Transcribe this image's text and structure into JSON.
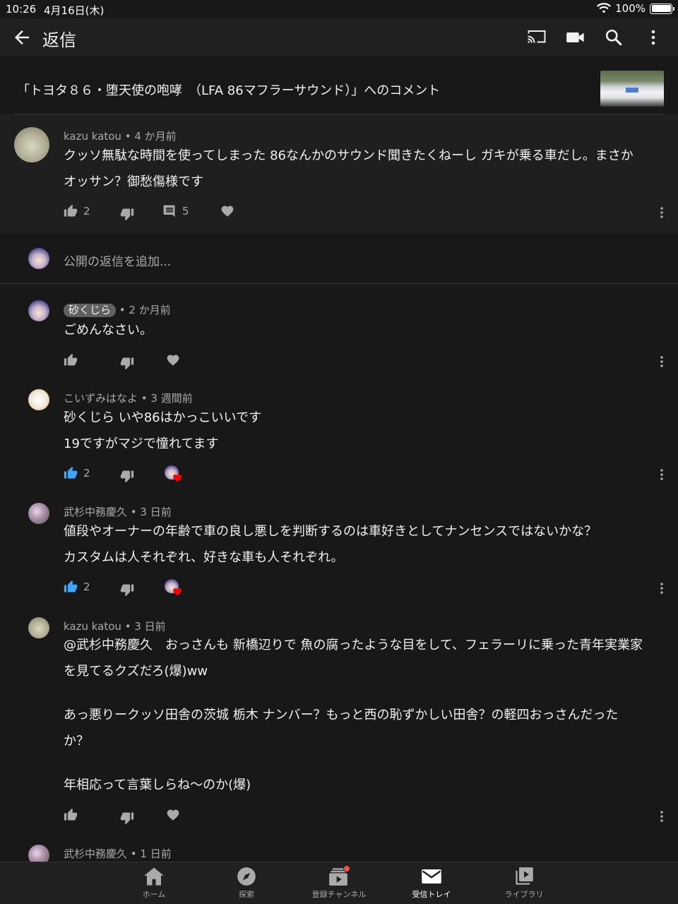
{
  "status_bar": {
    "time": "10:26",
    "date": "4月16日(木)",
    "battery": "100%"
  },
  "app_bar": {
    "title": "返信"
  },
  "video": {
    "title": "「トヨタ８６・堕天使の咆哮　（LFA 86マフラーサウンド）」へのコメント"
  },
  "parent_comment": {
    "author": "kazu katou",
    "time": "4 か月前",
    "meta": "kazu katou • 4 か月前",
    "lines": [
      "クッソ無駄な時間を使ってしまった 86なんかのサウンド聞きたくねーし ガキが乗る車だし。まさか",
      "オッサン？御愁傷様です"
    ],
    "likes": "2",
    "reply_count": "5"
  },
  "reply_input": {
    "placeholder": "公開の返信を追加..."
  },
  "replies": [
    {
      "author": "砂くじら",
      "time": "2 か月前",
      "sep": " • 2 か月前",
      "lines": [
        "ごめんなさい。"
      ],
      "likes": ""
    },
    {
      "author": "こいずみはなよ",
      "meta": "こいずみはなよ • 3 週間前",
      "lines": [
        "砂くじら いや86はかっこいいです",
        "19ですがマジで憧れてます"
      ],
      "likes": "2"
    },
    {
      "author": "武杉中務慶久",
      "meta": "武杉中務慶久 • 3 日前",
      "lines": [
        "値段やオーナーの年齢で車の良し悪しを判断するのは車好きとしてナンセンスではないかな？",
        "カスタムは人それぞれ、好きな車も人それぞれ。"
      ],
      "likes": "2"
    },
    {
      "author": "kazu katou",
      "meta": "kazu katou • 3 日前",
      "lines": [
        "@武杉中務慶久　おっさんも 新橋辺りで 魚の腐ったような目をして、フェラーリに乗った青年実業家",
        "を見てるクズだろ(爆)ww",
        "",
        "あっ悪りークッソ田舎の茨城 栃木 ナンバー？もっと西の恥ずかしい田舎？の軽四おっさんだった",
        "か？",
        "",
        "年相応って言葉しらね〜のか(爆)"
      ],
      "likes": ""
    },
    {
      "author": "武杉中務慶久",
      "meta": "武杉中務慶久 • 1 日前",
      "lines": [],
      "likes": ""
    }
  ],
  "bottom_nav": [
    {
      "label": "ホーム",
      "icon": "home-icon"
    },
    {
      "label": "探索",
      "icon": "explore-icon"
    },
    {
      "label": "登録チャンネル",
      "icon": "subscriptions-icon"
    },
    {
      "label": "受信トレイ",
      "icon": "inbox-icon"
    },
    {
      "label": "ライブラリ",
      "icon": "library-icon"
    }
  ],
  "colors": {
    "background": "#181818",
    "surface": "#1f1f1f",
    "accent_blue": "#3ea6ff",
    "heart_red": "#ff0000",
    "notification_red": "#ff4e45"
  }
}
